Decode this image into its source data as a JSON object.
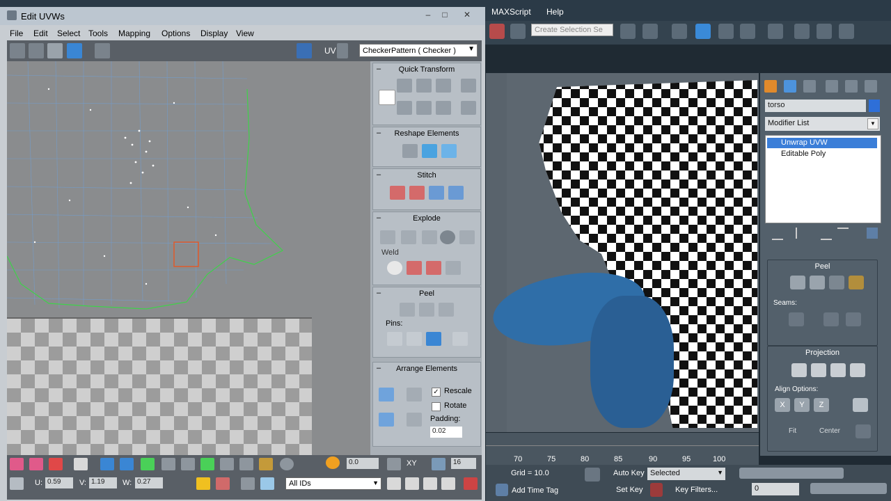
{
  "uvw_window": {
    "title": "Edit UVWs",
    "menu": [
      "File",
      "Edit",
      "Select",
      "Tools",
      "Mapping",
      "Options",
      "Display",
      "View"
    ],
    "uv_label": "UV",
    "texture_select": "CheckerPattern  ( Checker )",
    "panels": {
      "quick_transform": "Quick Transform",
      "reshape": "Reshape Elements",
      "stitch": "Stitch",
      "explode": "Explode",
      "weld": "Weld",
      "peel": "Peel",
      "pins": "Pins:",
      "arrange": "Arrange Elements",
      "rescale": "Rescale",
      "rotate": "Rotate",
      "padding": "Padding:",
      "padding_value": "0.02"
    },
    "bottom": {
      "value_a": "0.0",
      "xy": "XY",
      "value_b": "16",
      "u_label": "U:",
      "u_value": "0.59",
      "v_label": "V:",
      "v_value": "1.19",
      "w_label": "W:",
      "w_value": "0.27",
      "ids": "All IDs"
    }
  },
  "max": {
    "menu": [
      "MAXScript",
      "Help"
    ],
    "selection_set": "Create Selection Se",
    "object_name": "torso",
    "object_color": "#2e6fd8",
    "modifier_list": "Modifier List",
    "stack": [
      "Unwrap UVW",
      "Editable Poly"
    ],
    "peel_title": "Peel",
    "seams_label": "Seams:",
    "projection_title": "Projection",
    "align_label": "Align Options:",
    "axes": [
      "X",
      "Y",
      "Z"
    ],
    "fit": "Fit",
    "center": "Center",
    "timeline_ticks": [
      "70",
      "75",
      "80",
      "85",
      "90",
      "95",
      "100"
    ],
    "grid": "Grid = 10.0",
    "auto_key": "Auto Key",
    "selected": "Selected",
    "set_key": "Set Key",
    "key_filters": "Key Filters...",
    "add_time_tag": "Add Time Tag",
    "frame": "0"
  }
}
